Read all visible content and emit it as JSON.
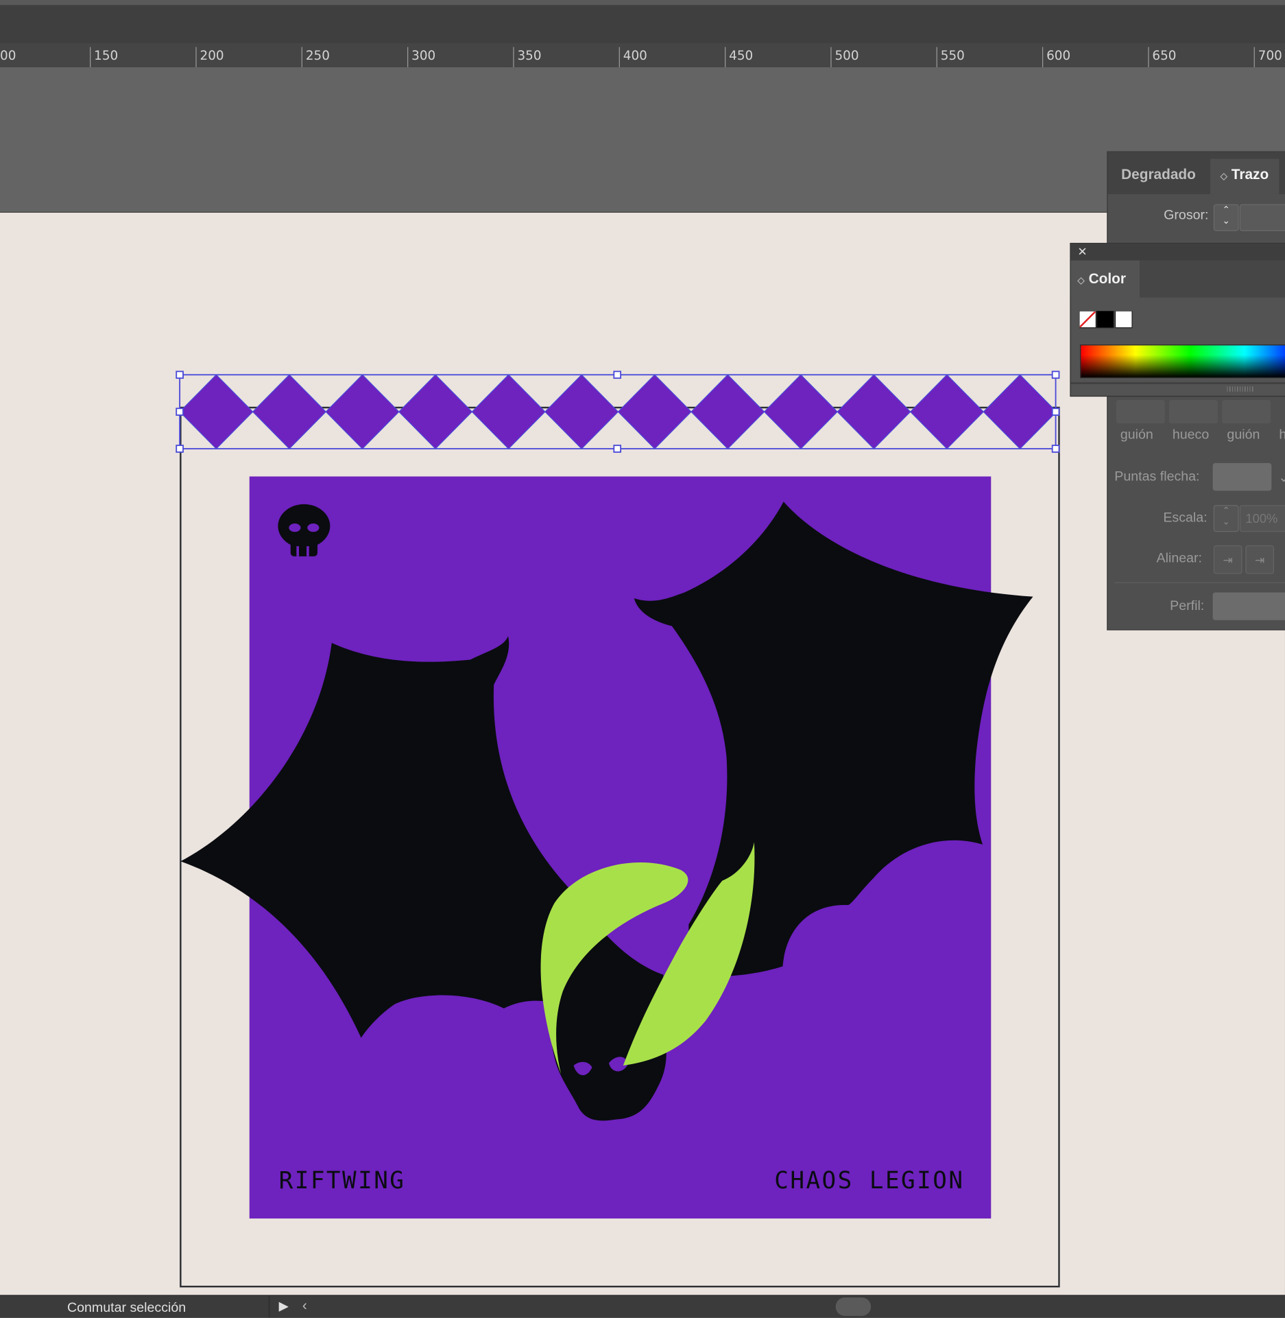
{
  "ruler": {
    "labels": [
      "00",
      "150",
      "200",
      "250",
      "300",
      "350",
      "400",
      "450",
      "500",
      "550",
      "600",
      "650",
      "700"
    ]
  },
  "poster": {
    "left_text": "RIFTWING",
    "right_text": "CHAOS LEGION"
  },
  "colors": {
    "poster_bg": "#6e22be",
    "wing": "#0a0c10",
    "horn": "#a8e04a",
    "selection": "#4a4ad8",
    "canvas": "#ebe3de"
  },
  "stroke_panel": {
    "tabs": [
      "Degradado",
      "Trazo"
    ],
    "weight_label": "Grosor:",
    "dash_labels": [
      "guión",
      "hueco",
      "guión",
      "h"
    ],
    "arrowheads_label": "Puntas flecha:",
    "scale_label": "Escala:",
    "scale_value": "100%",
    "align_label": "Alinear:",
    "profile_label": "Perfil:"
  },
  "color_panel": {
    "title": "Color",
    "close_glyph": "✕"
  },
  "status_bar": {
    "text": "Conmutar selección"
  }
}
